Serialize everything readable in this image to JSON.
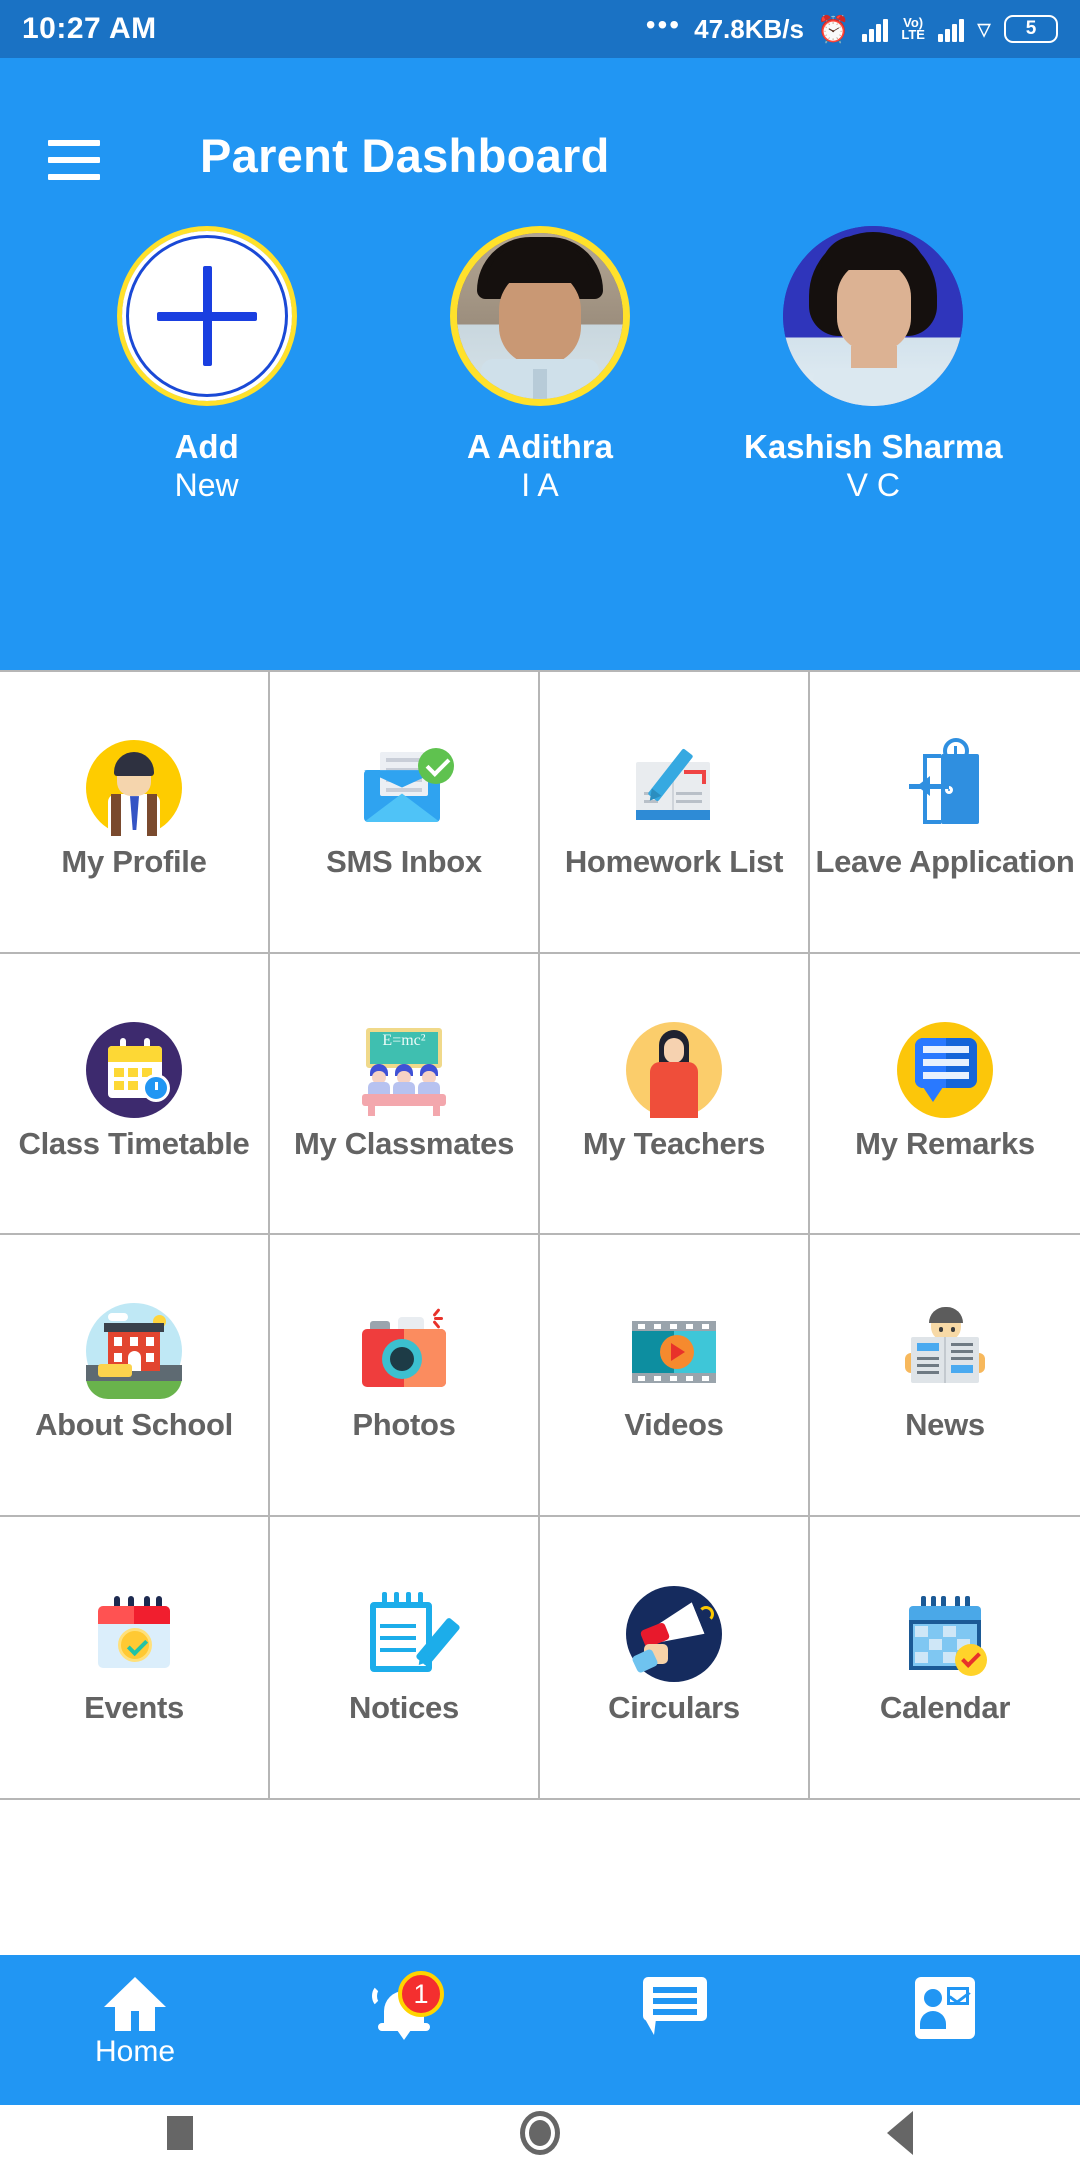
{
  "status_bar": {
    "time": "10:27 AM",
    "dots": "•••",
    "network_speed": "47.8KB/s",
    "volte_top": "Vo)",
    "volte_bottom": "LTE",
    "battery": "5",
    "icons": [
      "alarm-icon",
      "signal-icon",
      "volte-icon",
      "signal-icon-2",
      "wifi-icon",
      "battery-icon"
    ]
  },
  "header": {
    "title": "Parent Dashboard",
    "menu_icon": "hamburger-menu-icon",
    "accent_color": "#2196f3"
  },
  "students": [
    {
      "name": "Add",
      "class": "New",
      "avatar": "add-new-plus-icon",
      "selected": false,
      "is_add": true
    },
    {
      "name": "A Adithra",
      "class": "I A",
      "avatar": "student-photo",
      "selected": true,
      "is_add": false
    },
    {
      "name": "Kashish Sharma",
      "class": "V C",
      "avatar": "student-photo",
      "selected": false,
      "is_add": false
    }
  ],
  "menu": {
    "items": [
      {
        "label": "My Profile",
        "icon": "user-avatar-icon"
      },
      {
        "label": "SMS Inbox",
        "icon": "envelope-check-icon"
      },
      {
        "label": "Homework List",
        "icon": "book-pencil-icon"
      },
      {
        "label": "Leave Application",
        "icon": "door-exit-icon"
      },
      {
        "label": "Class Timetable",
        "icon": "calendar-clock-icon"
      },
      {
        "label": "My Classmates",
        "icon": "students-blackboard-icon"
      },
      {
        "label": "My Teachers",
        "icon": "teacher-icon"
      },
      {
        "label": "My Remarks",
        "icon": "speech-bubble-icon"
      },
      {
        "label": "About School",
        "icon": "school-building-icon"
      },
      {
        "label": "Photos",
        "icon": "camera-icon"
      },
      {
        "label": "Videos",
        "icon": "film-play-icon"
      },
      {
        "label": "News",
        "icon": "newspaper-reader-icon"
      },
      {
        "label": "Events",
        "icon": "calendar-check-icon"
      },
      {
        "label": "Notices",
        "icon": "notepad-pencil-icon"
      },
      {
        "label": "Circulars",
        "icon": "megaphone-icon"
      },
      {
        "label": "Calendar",
        "icon": "calendar-grid-icon"
      }
    ],
    "blackboard_text": "E=mc²"
  },
  "bottom_nav": {
    "items": [
      {
        "label": "Home",
        "icon": "home-icon",
        "badge": ""
      },
      {
        "label": "",
        "icon": "bell-icon",
        "badge": "1"
      },
      {
        "label": "",
        "icon": "chat-bubble-icon",
        "badge": ""
      },
      {
        "label": "",
        "icon": "contact-card-icon",
        "badge": ""
      }
    ]
  },
  "android_nav": {
    "recents": "square-recents-icon",
    "home": "circle-home-icon",
    "back": "triangle-back-icon"
  }
}
